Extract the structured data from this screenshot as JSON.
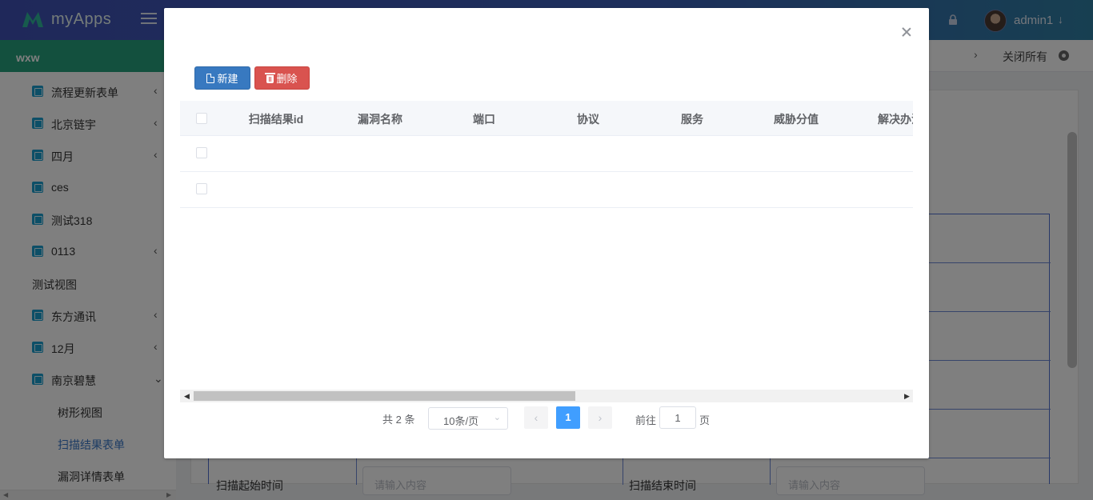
{
  "header": {
    "app_name": "myApps",
    "user_name": "admin1",
    "user_caret": "↓"
  },
  "sidebar": {
    "section_title": "wxw",
    "items": [
      {
        "label": "流程更新表单",
        "chevron": "‹"
      },
      {
        "label": "北京链宇",
        "chevron": "‹"
      },
      {
        "label": "四月",
        "chevron": "‹"
      },
      {
        "label": "ces",
        "chevron": ""
      },
      {
        "label": "测试318",
        "chevron": ""
      },
      {
        "label": "0113",
        "chevron": "‹"
      },
      {
        "label": "测试视图",
        "chevron": ""
      },
      {
        "label": "东方通讯",
        "chevron": "‹"
      },
      {
        "label": "12月",
        "chevron": "‹"
      },
      {
        "label": "南京碧慧",
        "chevron": "⌄"
      },
      {
        "label": "树形视图"
      },
      {
        "label": "扫描结果表单"
      },
      {
        "label": "漏洞详情表单"
      }
    ]
  },
  "tabbar": {
    "arrow": "›",
    "close_all": "关闭所有"
  },
  "background_form": {
    "scan_start_label": "扫描起始时间",
    "scan_end_label": "扫描结束时间",
    "input_placeholder": "请输入内容"
  },
  "dialog": {
    "toolbar": {
      "new_label": "新建",
      "delete_label": "删除"
    },
    "table": {
      "columns": [
        "扫描结果id",
        "漏洞名称",
        "端口",
        "协议",
        "服务",
        "威胁分值",
        "解决办法"
      ],
      "rows": [
        [],
        []
      ]
    },
    "pagination": {
      "total_text": "共 2 条",
      "page_size": "10条/页",
      "prev": "‹",
      "current_page": "1",
      "next": "›",
      "goto_label": "前往",
      "goto_value": "1",
      "goto_suffix": "页"
    }
  },
  "colors": {
    "header_gradient_start": "#3f51b5",
    "sidebar_head": "#26a17d",
    "new_button": "#3879c0",
    "delete_button": "#d9534f",
    "active_page": "#409eff"
  }
}
